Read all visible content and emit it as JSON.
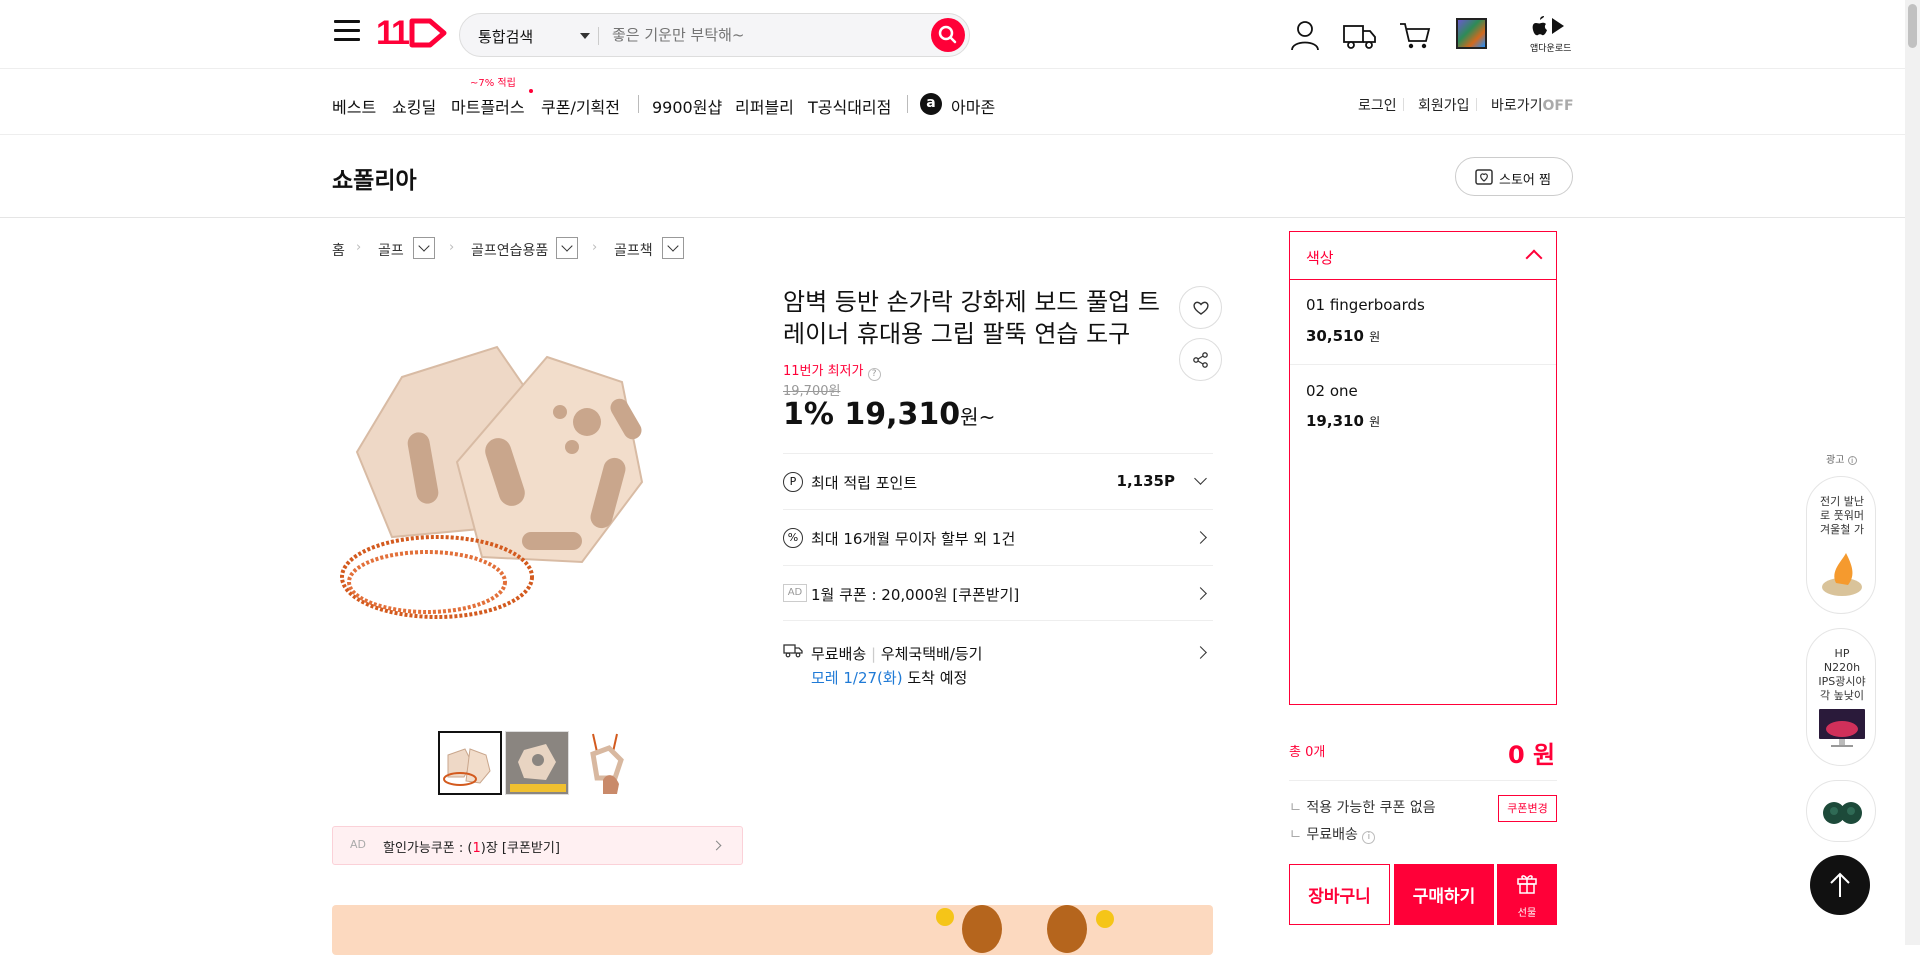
{
  "header": {
    "logo_text": "11",
    "search": {
      "category": "통합검색",
      "placeholder": "좋은 기운만 부탁해~"
    },
    "app_download_label": "앱다운로드"
  },
  "nav": {
    "items": [
      "베스트",
      "쇼킹딜",
      "마트플러스",
      "쿠폰/기획전",
      "9900원샵",
      "리퍼블리",
      "T공식대리점",
      "아마존"
    ],
    "promo_badge": "~7% 적립",
    "right": [
      "로그인",
      "회원가입",
      "바로가기"
    ],
    "shortcut_state": "OFF",
    "amazon_icon_letter": "a"
  },
  "store": {
    "name": "쇼폴리아",
    "zzim_label": "스토어 찜"
  },
  "breadcrumb": [
    "홈",
    "골프",
    "골프연습용품",
    "골프책"
  ],
  "product": {
    "title": "암벽 등반 손가락 강화제 보드 풀업 트레이너 휴대용 그립 팔뚝 연습 도구",
    "lowest_label": "11번가 최저가",
    "original_price": "19,700원",
    "discount": "1%",
    "price": "19,310",
    "price_suffix": "원~",
    "points_label": "최대 적립 포인트",
    "points_value": "1,135P",
    "installment": "최대 16개월 무이자 할부 외 1건",
    "ad_tag": "AD",
    "coupon_offer": "1월 쿠폰 : 20,000원 [쿠폰받기]",
    "shipping_free": "무료배송",
    "shipping_method": "우체국택배/등기",
    "arrival_date": "모레 1/27(화)",
    "arrival_suffix": "도착 예정",
    "discount_coupon": {
      "ad": "AD",
      "prefix": "할인가능쿠폰 : (",
      "count": "1",
      "suffix": ")장 [쿠폰받기]"
    }
  },
  "options": {
    "header": "색상",
    "items": [
      {
        "name": "01 fingerboards",
        "price": "30,510",
        "unit": "원"
      },
      {
        "name": "02 one",
        "price": "19,310",
        "unit": "원"
      }
    ]
  },
  "summary": {
    "total_label": "총 0개",
    "total_value": "0 원",
    "no_coupon": "적용 가능한 쿠폰 없음",
    "free_shipping": "무료배송",
    "coupon_change": "쿠폰변경",
    "cart_label": "장바구니",
    "buy_label": "구매하기",
    "gift_label": "선물"
  },
  "side_ads": {
    "label": "광고",
    "items": [
      "전기 발난로 풋워머 겨울철 가",
      "HP N220h IPS광시야각 높낮이"
    ]
  },
  "colors": {
    "brand": "#ff0038",
    "link_blue": "#1f7ad6"
  }
}
